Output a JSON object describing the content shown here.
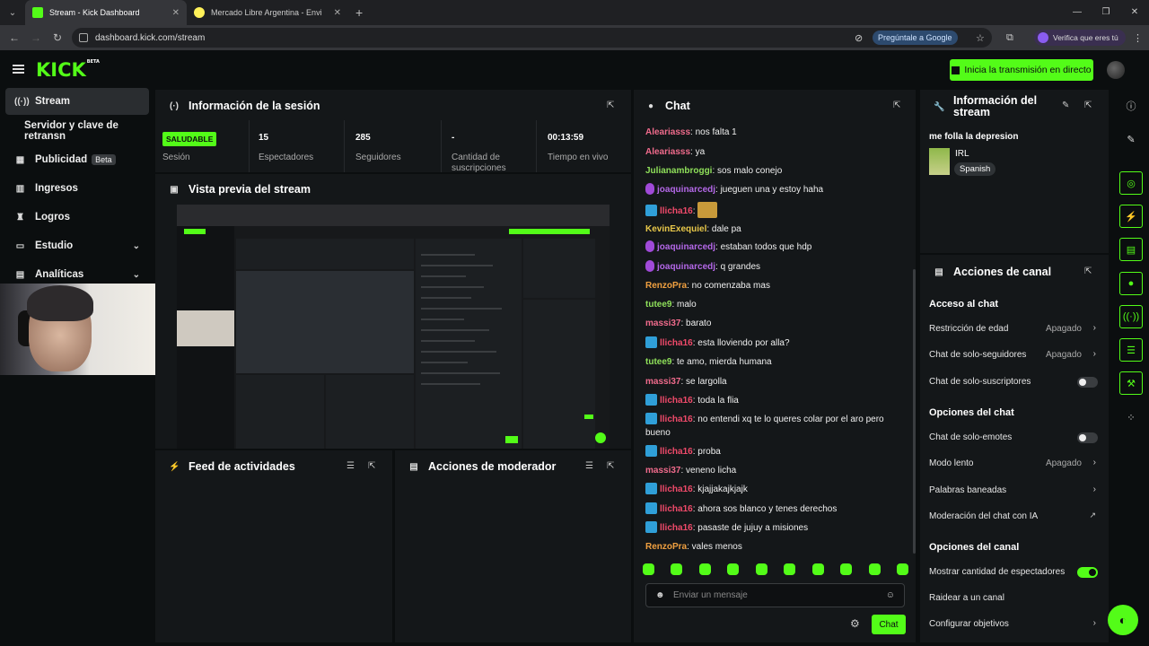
{
  "browser": {
    "tabs": [
      {
        "title": "Stream - Kick Dashboard"
      },
      {
        "title": "Mercado Libre Argentina - Envi"
      }
    ],
    "url": "dashboard.kick.com/stream",
    "ask_google": "Pregúntale a Google",
    "verify": "Verifica que eres tú"
  },
  "header": {
    "logo": "KICK",
    "logo_tag": "BETA",
    "go_live": "Inicia la transmisión en directo"
  },
  "sidebar": {
    "items": [
      {
        "label": "Stream",
        "icon": "stream-icon"
      },
      {
        "label": "Servidor y clave de retransn"
      },
      {
        "label": "Publicidad",
        "badge": "Beta",
        "icon": "calendar-icon"
      },
      {
        "label": "Ingresos",
        "icon": "chart-icon"
      },
      {
        "label": "Logros",
        "icon": "trophy-icon"
      },
      {
        "label": "Estudio",
        "icon": "studio-icon"
      },
      {
        "label": "Analíticas",
        "icon": "analytics-icon"
      }
    ]
  },
  "session": {
    "title": "Información de la sesión",
    "status": "SALUDABLE",
    "status_label": "Sesión",
    "viewers": "15",
    "viewers_label": "Espectadores",
    "followers": "285",
    "followers_label": "Seguidores",
    "subs": "-",
    "subs_label": "Cantidad de suscripciones",
    "live_time": "00:13:59",
    "live_time_label": "Tiempo en vivo"
  },
  "preview": {
    "title": "Vista previa del stream"
  },
  "activity": {
    "title": "Feed de actividades"
  },
  "moderator": {
    "title": "Acciones de moderador"
  },
  "chat": {
    "title": "Chat",
    "placeholder": "Enviar un mensaje",
    "send": "Chat",
    "messages": [
      {
        "user": "Aleariasss",
        "color": "#f06b8c",
        "text": ": nos falta 1"
      },
      {
        "user": "Aleariasss",
        "color": "#f06b8c",
        "text": ": ya"
      },
      {
        "user": "Julianambroggi",
        "color": "#8fe05a",
        "text": ": sos malo conejo"
      },
      {
        "user": "joaquinarcedj",
        "color": "#b468e8",
        "text": ": jueguen una y estoy haha",
        "badge": "mic"
      },
      {
        "user": "llicha16",
        "color": "#f04a6a",
        "text": ":",
        "badge": "mod",
        "emote": true
      },
      {
        "user": "KevinExequiel",
        "color": "#e8c84a",
        "text": ": dale pa"
      },
      {
        "user": "joaquinarcedj",
        "color": "#b468e8",
        "text": ": estaban todos que hdp",
        "badge": "mic"
      },
      {
        "user": "joaquinarcedj",
        "color": "#b468e8",
        "text": ": q grandes",
        "badge": "mic"
      },
      {
        "user": "RenzoPra",
        "color": "#f0a040",
        "text": ": no comenzaba mas"
      },
      {
        "user": "tutee9",
        "color": "#8fe05a",
        "text": ": malo"
      },
      {
        "user": "massi37",
        "color": "#f06b8c",
        "text": ": barato"
      },
      {
        "user": "llicha16",
        "color": "#f04a6a",
        "text": ": esta lloviendo por alla?",
        "badge": "mod"
      },
      {
        "user": "tutee9",
        "color": "#8fe05a",
        "text": ": te amo, mierda humana"
      },
      {
        "user": "massi37",
        "color": "#f06b8c",
        "text": ": se largolla"
      },
      {
        "user": "llicha16",
        "color": "#f04a6a",
        "text": ": toda la flia",
        "badge": "mod"
      },
      {
        "user": "llicha16",
        "color": "#f04a6a",
        "text": ": no entendi xq te lo queres colar por el aro pero bueno",
        "badge": "mod"
      },
      {
        "user": "llicha16",
        "color": "#f04a6a",
        "text": ": proba",
        "badge": "mod"
      },
      {
        "user": "massi37",
        "color": "#f06b8c",
        "text": ": veneno licha"
      },
      {
        "user": "llicha16",
        "color": "#f04a6a",
        "text": ": kjajjakajkjajk",
        "badge": "mod"
      },
      {
        "user": "llicha16",
        "color": "#f04a6a",
        "text": ": ahora sos blanco y tenes derechos",
        "badge": "mod"
      },
      {
        "user": "llicha16",
        "color": "#f04a6a",
        "text": ": pasaste de jujuy a misiones",
        "badge": "mod"
      },
      {
        "user": "RenzoPra",
        "color": "#f0a040",
        "text": ": vales menos"
      }
    ]
  },
  "stream_info": {
    "title": "Información del stream",
    "stream_title": "me folla la depresion",
    "category": "IRL",
    "language": "Spanish"
  },
  "channel_actions": {
    "title": "Acciones de canal",
    "chat_access": "Acceso al chat",
    "age_restriction": "Restricción de edad",
    "age_value": "Apagado",
    "followers_only": "Chat de solo-seguidores",
    "followers_value": "Apagado",
    "subs_only": "Chat de solo-suscriptores",
    "chat_options": "Opciones del chat",
    "emotes_only": "Chat de solo-emotes",
    "slow_mode": "Modo lento",
    "slow_value": "Apagado",
    "banned_words": "Palabras baneadas",
    "ai_mod": "Moderación del chat con IA",
    "channel_options": "Opciones del canal",
    "show_viewers": "Mostrar cantidad de espectadores",
    "raid": "Raidear a un canal",
    "goals": "Configurar objetivos"
  },
  "colors": {
    "accent": "#53fc18",
    "panel": "#141719",
    "bg": "#0b0e0f"
  }
}
